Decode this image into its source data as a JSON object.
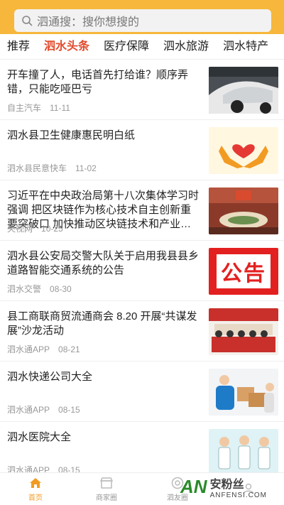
{
  "search": {
    "placeholder": "泗通搜：搜你想搜的",
    "icon": "search-icon"
  },
  "tabs": [
    {
      "label": "推荐",
      "active": false
    },
    {
      "label": "泗水头条",
      "active": true
    },
    {
      "label": "医疗保障",
      "active": false
    },
    {
      "label": "泗水旅游",
      "active": false
    },
    {
      "label": "泗水特产",
      "active": false
    }
  ],
  "news": [
    {
      "title": "开车撞了人，电话首先打给谁？顺序弄错，只能吃哑巴亏",
      "source": "自主汽车",
      "date": "11-11"
    },
    {
      "title": "泗水县卫生健康惠民明白纸",
      "source": "泗水县民意快车",
      "date": "11-02"
    },
    {
      "title": "习近平在中央政治局第十八次集体学习时强调 把区块链作为核心技术自主创新重要突破口 加快推动区块链技术和产业创新发展",
      "source": "央视网",
      "date": "10-25"
    },
    {
      "title": "泗水县公安局交警大队关于启用我县县乡道路智能交通系统的公告",
      "source": "泗水交警",
      "date": "08-30"
    },
    {
      "title": "县工商联商贸流通商会 8.20 开展“共谋发展”沙龙活动",
      "source": "泗水通APP",
      "date": "08-21"
    },
    {
      "title": "泗水快递公司大全",
      "source": "泗水通APP",
      "date": "08-15"
    },
    {
      "title": "泗水医院大全",
      "source": "泗水通APP",
      "date": "08-15"
    }
  ],
  "thumb_text": {
    "notice": "公告"
  },
  "tabbar": [
    {
      "label": "首页",
      "icon": "home-icon",
      "active": true
    },
    {
      "label": "商家圈",
      "icon": "shop-icon",
      "active": false
    },
    {
      "label": "泗友圈",
      "icon": "camera-aperture-icon",
      "active": false
    },
    {
      "label": "",
      "icon": "user-icon",
      "active": false
    }
  ],
  "watermark": {
    "logo": "AN",
    "cn": "安粉丝",
    "en": "ANFENSI.COM"
  },
  "colors": {
    "header": "#f6b73c",
    "active_tab": "#e14b2d",
    "active_nav": "#f29b23"
  }
}
